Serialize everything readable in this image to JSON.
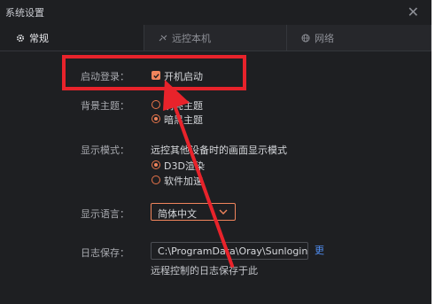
{
  "window": {
    "title": "系统设置",
    "close_glyph": "✕"
  },
  "tabs": [
    {
      "label": "常规",
      "icon": "gear-icon",
      "active": true
    },
    {
      "label": "远控本机",
      "icon": "link-icon",
      "active": false
    },
    {
      "label": "网络",
      "icon": "globe-icon",
      "active": false
    }
  ],
  "settings": {
    "startup": {
      "label": "启动登录：",
      "option": "开机启动",
      "checked": true
    },
    "theme": {
      "label": "背景主题：",
      "options": [
        "明亮主题",
        "暗黑主题"
      ],
      "selected_index": 1
    },
    "display": {
      "label": "显示模式：",
      "description": "远控其他设备时的画面显示模式",
      "options": [
        "D3D渲染",
        "软件加速"
      ],
      "selected_index": 0
    },
    "language": {
      "label": "显示语言：",
      "value": "简体中文"
    },
    "log": {
      "label": "日志保存：",
      "path": "C:\\ProgramData\\Oray\\SunloginC",
      "more": "更",
      "hint": "远程控制的日志保存于此"
    }
  },
  "colors": {
    "accent": "#f0845c",
    "annotation_red": "#e8232b",
    "link": "#4f8cf0",
    "background": "#1e1f22"
  }
}
